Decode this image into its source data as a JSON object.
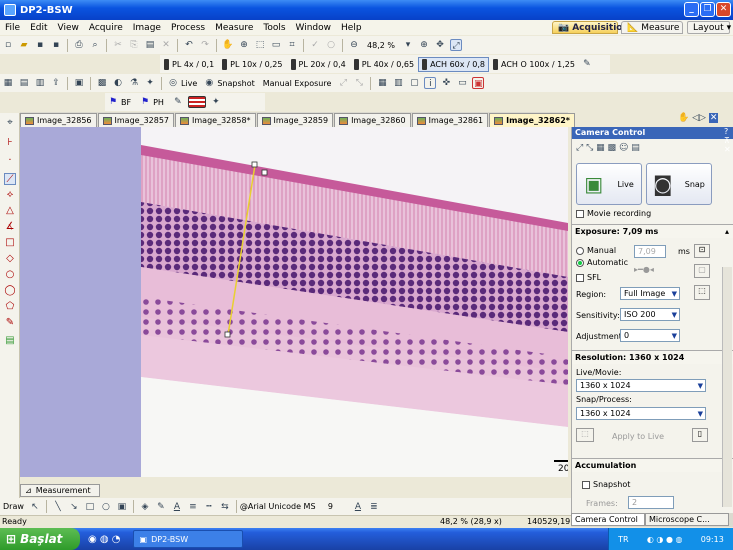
{
  "app": {
    "title": "DP2-BSW"
  },
  "menu": [
    "File",
    "Edit",
    "View",
    "Acquire",
    "Image",
    "Process",
    "Measure",
    "Tools",
    "Window",
    "Help"
  ],
  "workspaces": {
    "acquisition": "Acquisition",
    "measure": "Measure",
    "layout": "Layout"
  },
  "toolbar": {
    "zoom": "48,2 %",
    "objectives": [
      "PL 4x / 0,1",
      "PL 10x / 0,25",
      "PL 20x / 0,4",
      "PL 40x / 0,65",
      "ACH 60x / 0,8",
      "ACH O 100x / 1,25"
    ],
    "selected_objective": "ACH 60x / 0,8",
    "live": "Live",
    "snapshot": "Snapshot",
    "manual_exposure": "Manual Exposure",
    "bf": "BF",
    "ph": "PH"
  },
  "image_tabs": [
    "Image_32856",
    "Image_32857",
    "Image_32858*",
    "Image_32859",
    "Image_32860",
    "Image_32861",
    "Image_32862*"
  ],
  "active_tab": "Image_32862*",
  "scalebar_text": "20",
  "camera": {
    "title": "Camera Control",
    "live": "Live",
    "snap": "Snap",
    "movie_recording": "Movie recording",
    "exposure_header": "Exposure: 7,09 ms",
    "manual": "Manual",
    "automatic": "Automatic",
    "exposure_value": "7,09",
    "exposure_unit": "ms",
    "sfl": "SFL",
    "region_label": "Region:",
    "region_value": "Full Image",
    "sensitivity_label": "Sensitivity:",
    "sensitivity_value": "ISO 200",
    "adjustment_label": "Adjustment:",
    "adjustment_value": "0",
    "resolution_header": "Resolution: 1360 x 1024",
    "live_movie_label": "Live/Movie:",
    "live_movie_value": "1360 x 1024",
    "snap_process_label": "Snap/Process:",
    "snap_process_value": "1360 x 1024",
    "apply_to_live": "Apply to Live",
    "accumulation_header": "Accumulation",
    "acc_snapshot": "Snapshot",
    "frames_label": "Frames:",
    "frames_value": "2"
  },
  "bottom_tabs": {
    "measurement": "Measurement",
    "camera_control": "Camera Control",
    "microscope": "Microscope C..."
  },
  "draw_toolbar": {
    "draw": "Draw",
    "font": "@Arial Unicode MS",
    "size": "9"
  },
  "status": {
    "ready": "Ready",
    "zoom": "48,2 % (28,9 x)",
    "coords": "140529,19"
  },
  "taskbar": {
    "start": "Başlat",
    "task": "DP2-BSW",
    "lang": "TR",
    "time": "09:13"
  }
}
